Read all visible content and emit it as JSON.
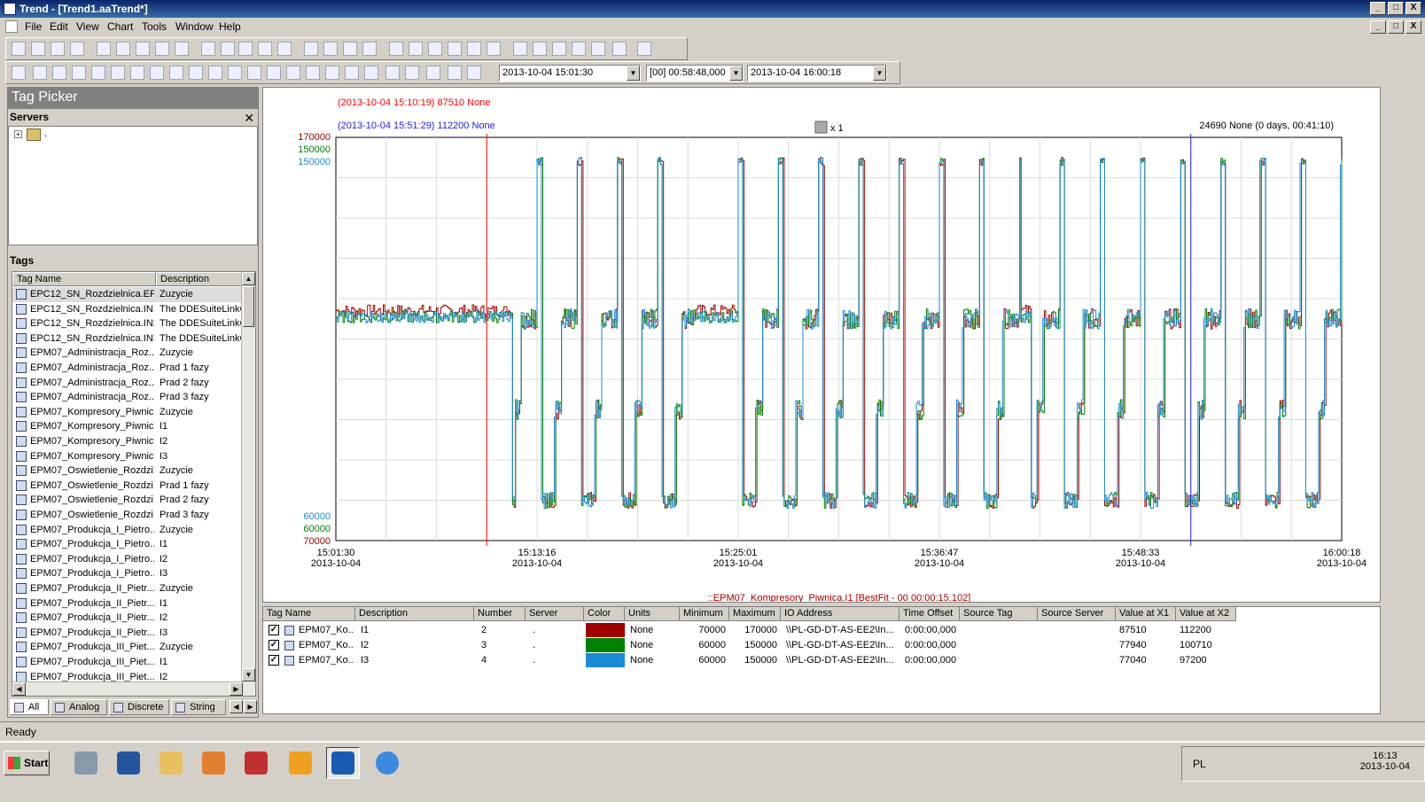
{
  "window": {
    "title": "Trend - [Trend1.aaTrend*]",
    "min": "_",
    "max": "□",
    "close": "X"
  },
  "menu": [
    "File",
    "Edit",
    "View",
    "Chart",
    "Tools",
    "Window",
    "Help"
  ],
  "timebar": {
    "start": "2013-10-04 15:01:30",
    "duration": "[00] 00:58:48,000",
    "end": "2013-10-04 16:00:18"
  },
  "left": {
    "title": "Tag Picker",
    "servers_label": "Servers",
    "servers_close": "✕",
    "server_node": ".",
    "tags_label": "Tags",
    "col_name": "Tag Name",
    "col_desc": "Description",
    "tags": [
      {
        "n": "EPC12_SN_Rozdzielnica.EP...",
        "d": "Zuzycie"
      },
      {
        "n": "EPC12_SN_Rozdzielnica.IN1",
        "d": "The DDESuiteLinkC"
      },
      {
        "n": "EPC12_SN_Rozdzielnica.IN2",
        "d": "The DDESuiteLinkC"
      },
      {
        "n": "EPC12_SN_Rozdzielnica.IN3",
        "d": "The DDESuiteLinkC"
      },
      {
        "n": "EPM07_Administracja_Roz...",
        "d": "Zuzycie"
      },
      {
        "n": "EPM07_Administracja_Roz...",
        "d": "Prad 1 fazy"
      },
      {
        "n": "EPM07_Administracja_Roz...",
        "d": "Prad 2 fazy"
      },
      {
        "n": "EPM07_Administracja_Roz...",
        "d": "Prad 3 fazy"
      },
      {
        "n": "EPM07_Kompresory_Piwnic...",
        "d": "Zuzycie"
      },
      {
        "n": "EPM07_Kompresory_Piwnic...",
        "d": "I1"
      },
      {
        "n": "EPM07_Kompresory_Piwnic...",
        "d": "I2"
      },
      {
        "n": "EPM07_Kompresory_Piwnic...",
        "d": "I3"
      },
      {
        "n": "EPM07_Oswietlenie_Rozdzi...",
        "d": "Zuzycie"
      },
      {
        "n": "EPM07_Oswietlenie_Rozdzi...",
        "d": "Prad 1 fazy"
      },
      {
        "n": "EPM07_Oswietlenie_Rozdzi...",
        "d": "Prad 2 fazy"
      },
      {
        "n": "EPM07_Oswietlenie_Rozdzi...",
        "d": "Prad 3 fazy"
      },
      {
        "n": "EPM07_Produkcja_I_Pietro...",
        "d": "Zuzycie"
      },
      {
        "n": "EPM07_Produkcja_I_Pietro...",
        "d": "I1"
      },
      {
        "n": "EPM07_Produkcja_I_Pietro...",
        "d": "I2"
      },
      {
        "n": "EPM07_Produkcja_I_Pietro...",
        "d": "I3"
      },
      {
        "n": "EPM07_Produkcja_II_Pietr...",
        "d": "Zuzycie"
      },
      {
        "n": "EPM07_Produkcja_II_Pietr...",
        "d": "I1"
      },
      {
        "n": "EPM07_Produkcja_II_Pietr...",
        "d": "I2"
      },
      {
        "n": "EPM07_Produkcja_II_Pietr...",
        "d": "I3"
      },
      {
        "n": "EPM07_Produkcja_III_Piet...",
        "d": "Zuzycie"
      },
      {
        "n": "EPM07_Produkcja_III_Piet...",
        "d": "I1"
      },
      {
        "n": "EPM07_Produkcja_III_Piet...",
        "d": "I2"
      }
    ],
    "tabs": [
      "All",
      "Analog",
      "Discrete",
      "String"
    ]
  },
  "chart": {
    "cursor1_label": "(2013-10-04 15:10:19) 87510 None",
    "cursor2_label": "(2013-10-04 15:51:29) 112200 None",
    "delta_label": "24690 None (0 days, 00:41:10)",
    "zoom_label": "x 1",
    "footer_label": "::EPM07_Kompresory_Piwnica.I1 [BestFit - 00 00:00:15.102]",
    "colors": {
      "red": "#a00000",
      "green": "#008000",
      "blue": "#1a8ad4",
      "cursor1": "#ff0000",
      "cursor2": "#2020ff"
    }
  },
  "chart_data": {
    "type": "line",
    "x_ticks": [
      {
        "time": "15:01:30",
        "date": "2013-10-04"
      },
      {
        "time": "15:13:16",
        "date": "2013-10-04"
      },
      {
        "time": "15:25:01",
        "date": "2013-10-04"
      },
      {
        "time": "15:36:47",
        "date": "2013-10-04"
      },
      {
        "time": "15:48:33",
        "date": "2013-10-04"
      },
      {
        "time": "16:00:18",
        "date": "2013-10-04"
      }
    ],
    "xlim_minutes": [
      0,
      58.8
    ],
    "cursor1_minute": 8.82,
    "cursor2_minute": 49.98,
    "series": [
      {
        "name": "I1",
        "color": "#a00000",
        "ylim": [
          70000,
          170000
        ],
        "y_labels": [
          "170000",
          "70000"
        ]
      },
      {
        "name": "I2",
        "color": "#008000",
        "ylim": [
          60000,
          150000
        ],
        "y_labels": [
          "150000",
          "60000"
        ]
      },
      {
        "name": "I3",
        "color": "#1a8ad4",
        "ylim": [
          60000,
          150000
        ],
        "y_labels": [
          "150000",
          "60000"
        ]
      }
    ],
    "grid": true
  },
  "grid": {
    "headers": [
      "Tag Name",
      "Description",
      "Number",
      "Server",
      "Color",
      "Units",
      "Minimum",
      "Maximum",
      "IO Address",
      "Time Offset",
      "Source Tag",
      "Source Server",
      "Value at X1",
      "Value at X2"
    ],
    "rows": [
      {
        "tag": "EPM07_Ko...",
        "desc": "I1",
        "num": "2",
        "server": ".",
        "color": "#a00000",
        "units": "None",
        "min": "70000",
        "max": "170000",
        "io": "\\\\PL-GD-DT-AS-EE2\\In...",
        "offset": "0:00:00,000",
        "x1": "87510",
        "x2": "112200"
      },
      {
        "tag": "EPM07_Ko...",
        "desc": "I2",
        "num": "3",
        "server": ".",
        "color": "#008000",
        "units": "None",
        "min": "60000",
        "max": "150000",
        "io": "\\\\PL-GD-DT-AS-EE2\\In...",
        "offset": "0:00:00,000",
        "x1": "77940",
        "x2": "100710"
      },
      {
        "tag": "EPM07_Ko...",
        "desc": "I3",
        "num": "4",
        "server": ".",
        "color": "#1a8ad4",
        "units": "None",
        "min": "60000",
        "max": "150000",
        "io": "\\\\PL-GD-DT-AS-EE2\\In...",
        "offset": "0:00:00,000",
        "x1": "77040",
        "x2": "97200"
      }
    ]
  },
  "status": "Ready",
  "taskbar": {
    "start": "Start",
    "lang": "PL",
    "time": "16:13",
    "date": "2013-10-04"
  }
}
